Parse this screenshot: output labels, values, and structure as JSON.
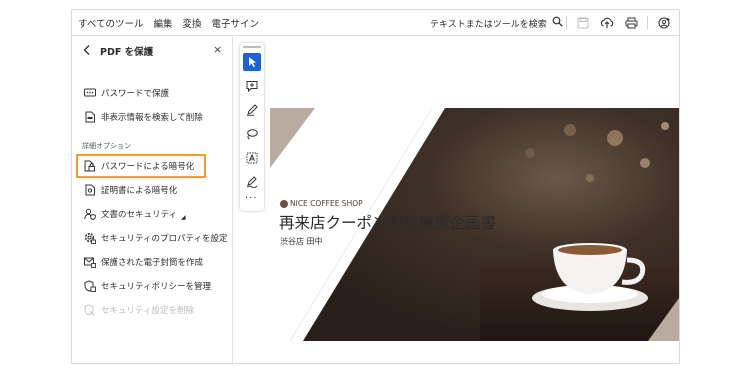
{
  "menu": [
    "すべてのツール",
    "編集",
    "変換",
    "電子サイン"
  ],
  "search_label": "テキストまたはツールを検索",
  "toolbar_icons": [
    "search-icon",
    "save-icon",
    "upload-icon",
    "print-icon",
    "share-user-icon",
    "link-icon"
  ],
  "panel": {
    "title": "PDF を保護",
    "close": "×",
    "items": [
      {
        "label": "パスワードで保護",
        "icon": "password-icon"
      },
      {
        "label": "非表示情報を検索して削除",
        "icon": "redact-doc-icon"
      }
    ],
    "section_label": "詳細オプション",
    "advanced": [
      {
        "label": "パスワードによる暗号化",
        "icon": "lock-doc-icon"
      },
      {
        "label": "証明書による暗号化",
        "icon": "certificate-icon"
      },
      {
        "label": "文書のセキュリティ",
        "icon": "user-shield-icon"
      },
      {
        "label": "セキュリティのプロパティを設定",
        "icon": "settings-lock-icon"
      },
      {
        "label": "保護された電子封筒を作成",
        "icon": "envelope-lock-icon"
      },
      {
        "label": "セキュリティポリシーを管理",
        "icon": "policy-icon"
      },
      {
        "label": "セキュリティ設定を削除",
        "icon": "remove-security-icon",
        "disabled": true
      }
    ]
  },
  "floating_tools": [
    "select-arrow-icon",
    "comment-icon",
    "pen-icon",
    "lasso-icon",
    "text-box-icon",
    "signature-icon"
  ],
  "more": "···",
  "document": {
    "brand": "NICE COFFEE SHOP",
    "title": "再来店クーポン配信施策企画書",
    "subtitle": "渋谷店 田中"
  },
  "colors": {
    "accent_blue": "#1b62d6",
    "highlight_orange": "#f39c2b",
    "panel_border": "#e2e2e2"
  }
}
